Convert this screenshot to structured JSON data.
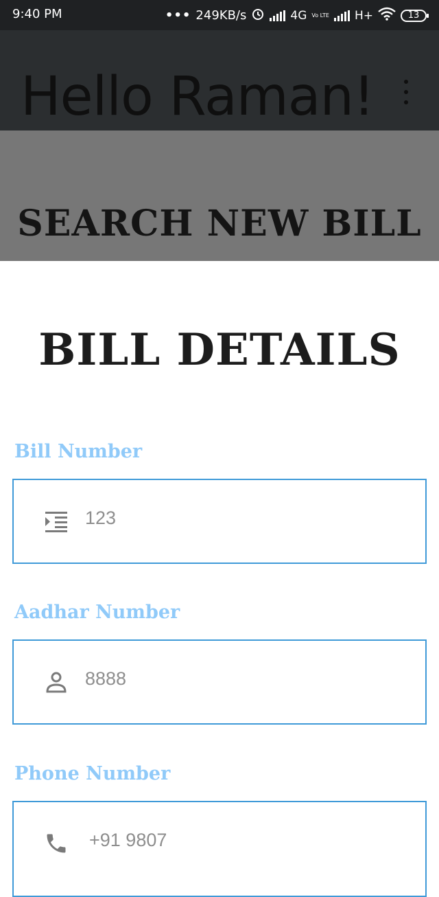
{
  "status_bar": {
    "time": "9:40 PM",
    "network_speed": "249KB/s",
    "network_1": "4G",
    "volte": "Vo LTE",
    "network_2": "H+",
    "battery": "13"
  },
  "app_bar": {
    "greeting": "Hello Raman!",
    "menu_icon": "more-vert-icon"
  },
  "banner": {
    "label": "SEARCH NEW BILL"
  },
  "form": {
    "title": "BILL DETAILS",
    "fields": [
      {
        "label": "Bill Number",
        "value": "123",
        "icon": "format-indent-icon"
      },
      {
        "label": "Aadhar Number",
        "value": "8888",
        "icon": "person-icon"
      },
      {
        "label": "Phone Number",
        "value": "+91 9807",
        "icon": "phone-icon"
      }
    ]
  },
  "colors": {
    "label": "#90caf9",
    "field_border": "#3f9ad8",
    "banner": "#777777",
    "app_bar": "#2b2e30"
  }
}
